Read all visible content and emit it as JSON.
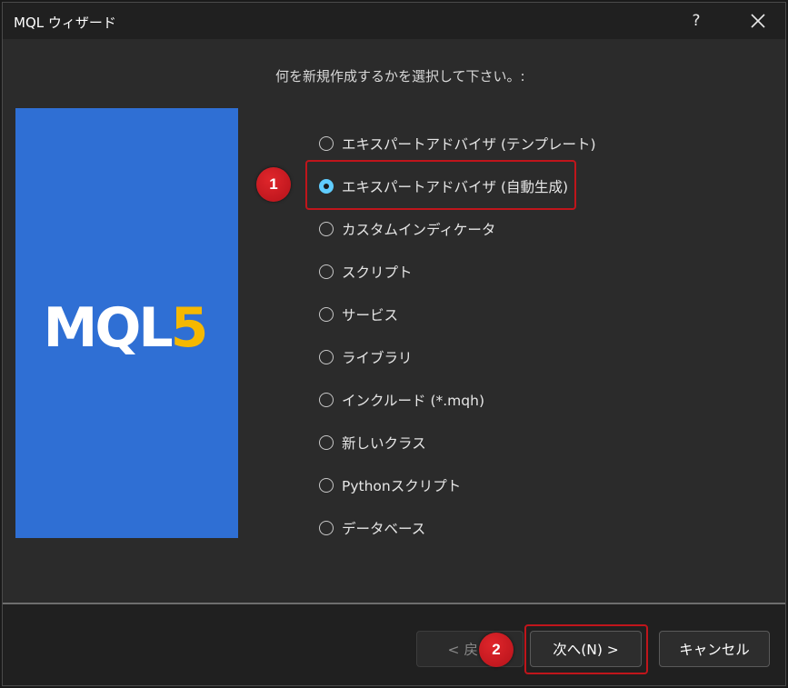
{
  "window": {
    "title": "MQL ウィザード",
    "help_label": "?",
    "close_icon": "close-icon"
  },
  "prompt": "何を新規作成するかを選択して下さい。:",
  "logo": {
    "text_main": "MQL",
    "text_accent": "5",
    "bg_color": "#2f6fd4",
    "accent_color": "#f5b800"
  },
  "options": [
    {
      "label": "エキスパートアドバイザ (テンプレート)",
      "checked": false
    },
    {
      "label": "エキスパートアドバイザ (自動生成)",
      "checked": true
    },
    {
      "label": "カスタムインディケータ",
      "checked": false
    },
    {
      "label": "スクリプト",
      "checked": false
    },
    {
      "label": "サービス",
      "checked": false
    },
    {
      "label": "ライブラリ",
      "checked": false
    },
    {
      "label": "インクルード (*.mqh)",
      "checked": false
    },
    {
      "label": "新しいクラス",
      "checked": false
    },
    {
      "label": "Pythonスクリプト",
      "checked": false
    },
    {
      "label": "データベース",
      "checked": false
    }
  ],
  "annotations": {
    "badge1": "1",
    "badge2": "2",
    "highlight_color": "#c0151b"
  },
  "buttons": {
    "back": "< 戻る",
    "next": "次へ(N) >",
    "cancel": "キャンセル"
  }
}
